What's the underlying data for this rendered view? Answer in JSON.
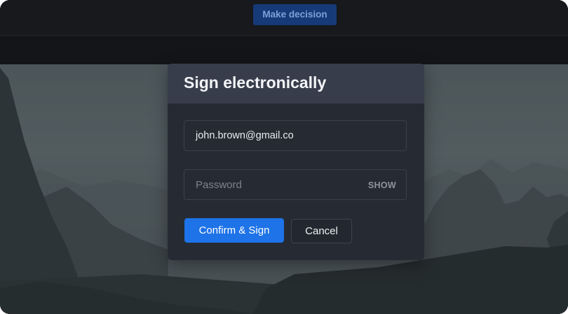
{
  "header": {
    "make_decision_label": "Make decision"
  },
  "modal": {
    "title": "Sign electronically",
    "email_value": "john.brown@gmail.co",
    "password_placeholder": "Password",
    "show_label": "SHOW",
    "confirm_label": "Confirm & Sign",
    "cancel_label": "Cancel"
  },
  "colors": {
    "accent": "#1e73e8",
    "header_button": "#163a78",
    "modal_background": "#262b33",
    "modal_header": "#373d4b"
  }
}
